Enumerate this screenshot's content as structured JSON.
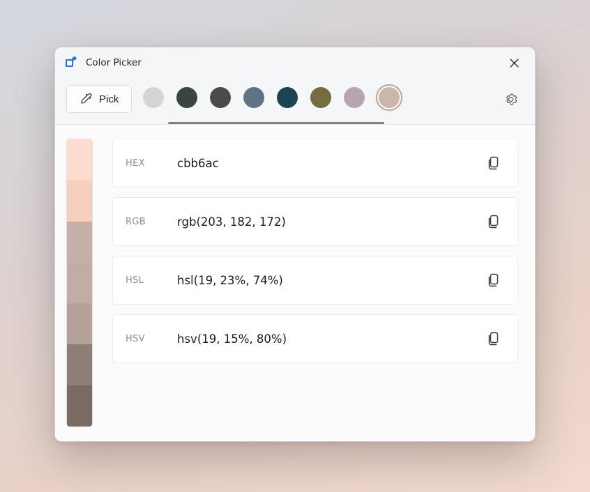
{
  "title": "Color Picker",
  "pick_label": "Pick",
  "swatches": [
    {
      "color": "#d4d4d4",
      "selected": false
    },
    {
      "color": "#3a4540",
      "selected": false
    },
    {
      "color": "#4c4c46",
      "selected": false
    },
    {
      "color": "#5f7286",
      "selected": false
    },
    {
      "color": "#1e4350",
      "selected": false
    },
    {
      "color": "#726c3e",
      "selected": false
    },
    {
      "color": "#b6a5b0",
      "selected": false
    },
    {
      "color": "#cbb6ac",
      "selected": true
    }
  ],
  "shades": [
    "#fcdccc",
    "#f6cfbf",
    "#c5b1a7",
    "#c0ada3",
    "#b4a197",
    "#8e7f76",
    "#7a6c63"
  ],
  "formats": [
    {
      "label": "HEX",
      "value": "cbb6ac"
    },
    {
      "label": "RGB",
      "value": "rgb(203, 182, 172)"
    },
    {
      "label": "HSL",
      "value": "hsl(19, 23%, 74%)"
    },
    {
      "label": "HSV",
      "value": "hsv(19, 15%, 80%)"
    }
  ]
}
